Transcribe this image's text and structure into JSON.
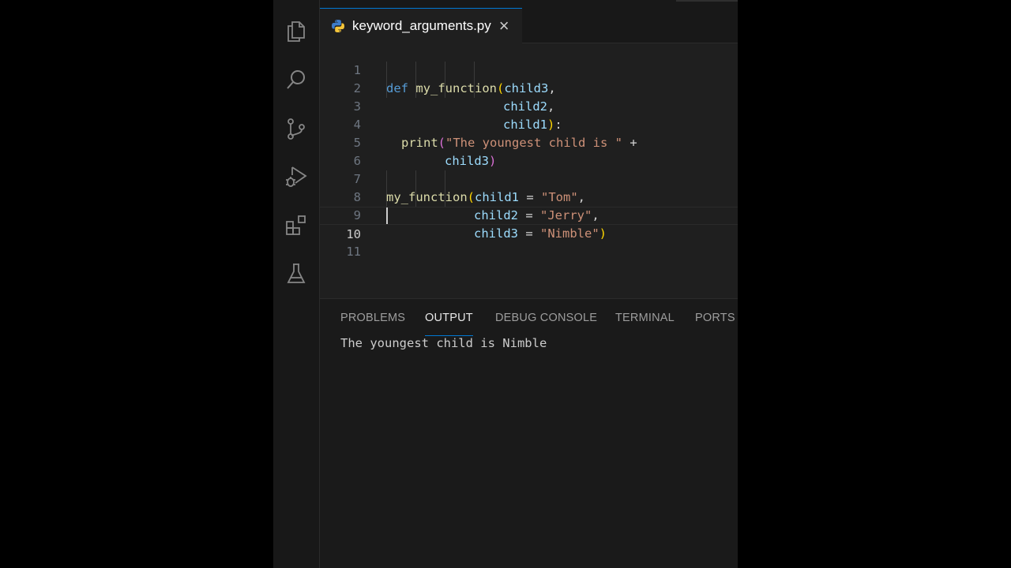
{
  "editor": {
    "tab": {
      "filename": "keyword_arguments.py",
      "close_glyph": "×",
      "icon": "python-icon"
    },
    "line_numbers": [
      "1",
      "2",
      "3",
      "4",
      "5",
      "6",
      "7",
      "8",
      "9",
      "10",
      "11"
    ],
    "active_line": "10",
    "code": {
      "l1": {
        "kw": "def",
        "fn": "my_function",
        "open": "(",
        "p": "child3",
        "comma": ","
      },
      "l2": {
        "p": "child2",
        "comma": ","
      },
      "l3": {
        "p": "child1",
        "close": ")",
        "colon": ":"
      },
      "l4": {
        "fn": "print",
        "open": "(",
        "str": "\"The youngest child is \"",
        "op": " +"
      },
      "l5": {
        "p": "child3",
        "close": ")"
      },
      "l7": {
        "fn": "my_function",
        "open": "(",
        "p": "child1",
        "eq": " = ",
        "str": "\"Tom\"",
        "comma": ","
      },
      "l8": {
        "p": "child2",
        "eq": " = ",
        "str": "\"Jerry\"",
        "comma": ","
      },
      "l9": {
        "p": "child3",
        "eq": " = ",
        "str": "\"Nimble\"",
        "close": ")"
      }
    }
  },
  "activity_bar": {
    "icons": [
      "files-icon",
      "search-icon",
      "source-control-icon",
      "run-debug-icon",
      "extensions-icon",
      "testing-flask-icon"
    ]
  },
  "panel": {
    "tabs": [
      "PROBLEMS",
      "OUTPUT",
      "DEBUG CONSOLE",
      "TERMINAL",
      "PORTS"
    ],
    "active_tab": "OUTPUT",
    "output": "The youngest child is Nimble"
  },
  "colors": {
    "keyword": "#569cd6",
    "function": "#dcdcaa",
    "parameter": "#9cdcfe",
    "string": "#ce9178",
    "bracket": "#ffd700",
    "accent": "#0078d4"
  }
}
